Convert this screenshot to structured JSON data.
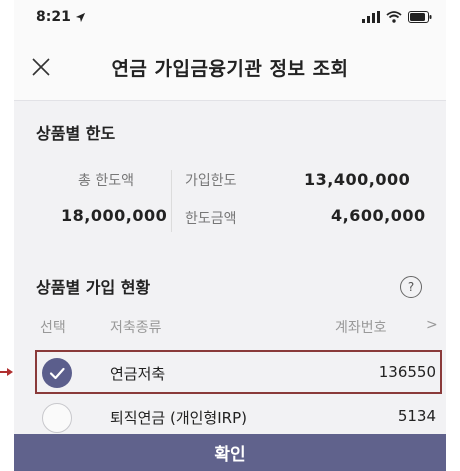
{
  "status_bar": {
    "time": "8:21",
    "location_icon": "location-arrow-icon",
    "signal_icon": "cellular-signal-icon",
    "wifi_icon": "wifi-icon",
    "battery_icon": "battery-icon"
  },
  "header": {
    "title": "연금 가입금융기관 정보 조회",
    "close_icon": "close-icon"
  },
  "limits": {
    "section_title": "상품별 한도",
    "total_label": "총 한도액",
    "total_value": "18,000,000",
    "join_limit_label": "가입한도",
    "join_limit_value": "13,400,000",
    "limit_amount_label": "한도금액",
    "limit_amount_value": "4,600,000"
  },
  "status_section": {
    "section_title": "상품별 가입 현황",
    "help_icon": "question-circle-icon",
    "help_glyph": "?",
    "columns": {
      "select": "선택",
      "type": "저축종류",
      "account": "계좌번호",
      "more": ">"
    },
    "rows": [
      {
        "name": "연금저축",
        "account": "136550",
        "checked": true
      },
      {
        "name": "퇴직연금 (개인형IRP)",
        "account": "5134",
        "checked": false
      }
    ]
  },
  "footer": {
    "confirm_label": "확인"
  },
  "colors": {
    "accent": "#60628c",
    "checked": "#5b5e8c",
    "highlight_border": "#8a3a3a"
  }
}
